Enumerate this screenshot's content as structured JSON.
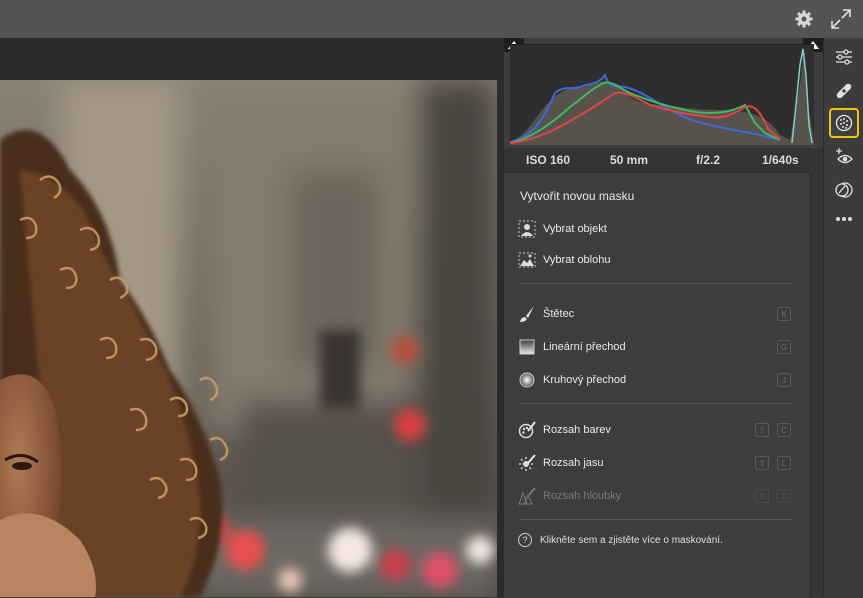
{
  "exif": {
    "iso": "ISO 160",
    "focal": "50 mm",
    "aperture": "f/2.2",
    "shutter": "1/640s"
  },
  "panel": {
    "title": "Vytvořit novou masku",
    "items": [
      {
        "label": "Vybrat objekt",
        "icon": "select-subject-icon"
      },
      {
        "label": "Vybrat oblohu",
        "icon": "select-sky-icon"
      },
      {
        "label": "Štětec",
        "icon": "brush-icon",
        "keys": [
          "K"
        ]
      },
      {
        "label": "Lineární přechod",
        "icon": "linear-gradient-icon",
        "keys": [
          "G"
        ]
      },
      {
        "label": "Kruhový přechod",
        "icon": "radial-gradient-icon",
        "keys": [
          "J"
        ]
      },
      {
        "label": "Rozsah barev",
        "icon": "color-range-icon",
        "keys": [
          "⇧",
          "C"
        ]
      },
      {
        "label": "Rozsah jasu",
        "icon": "luminance-range-icon",
        "keys": [
          "⇧",
          "L"
        ]
      },
      {
        "label": "Rozsah hloubky",
        "icon": "depth-range-icon",
        "keys": [
          "⇧",
          "D"
        ],
        "disabled": true
      }
    ],
    "help": "Klikněte sem a zjistěte více o maskování."
  },
  "toolbar": {
    "tools": [
      "edit-sliders-icon",
      "healing-icon",
      "masking-icon",
      "red-eye-icon",
      "presets-icon",
      "more-icon"
    ],
    "active": "masking-icon"
  },
  "colors": {
    "accent": "#f5c400",
    "panel_bg": "#3d3d3d",
    "topbar_bg": "#535353"
  }
}
